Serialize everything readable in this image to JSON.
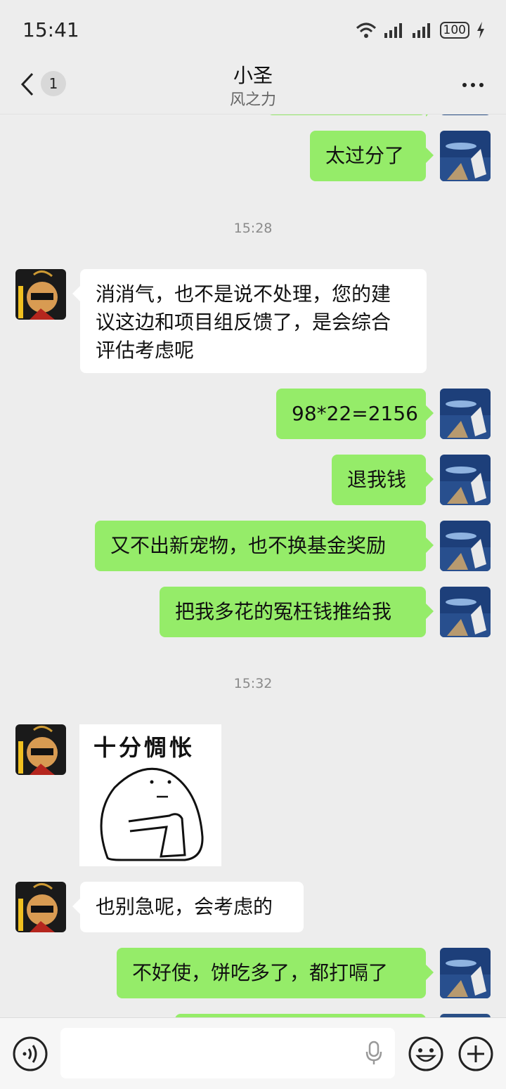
{
  "status": {
    "time": "15:41",
    "battery": "100"
  },
  "header": {
    "unread": "1",
    "name": "小圣",
    "subtitle": "风之力"
  },
  "messages": [
    {
      "text": "太过分了"
    },
    {
      "time": "15:28"
    },
    {
      "lines": [
        "消消气，也不是说不处理，您的建",
        "议这边和项目组反馈了，是会综合",
        "评估考虑呢"
      ]
    },
    {
      "text": "98*22=2156"
    },
    {
      "text": "退我钱"
    },
    {
      "text": "又不出新宠物，也不换基金奖励"
    },
    {
      "text": "把我多花的冤枉钱推给我"
    },
    {
      "time": "15:32"
    },
    {
      "sticker_text": "十分惆怅"
    },
    {
      "text": "也别急呢，会考虑的"
    },
    {
      "text": "不好使，饼吃多了，都打嗝了"
    }
  ],
  "icons": {
    "back": "chevron-left-icon",
    "more": "more-dots-icon",
    "voice": "voice-icon",
    "mic": "microphone-icon",
    "emoji": "emoji-icon",
    "plus": "plus-icon",
    "wifi": "wifi-icon",
    "signal": "signal-icon",
    "charging": "charging-icon"
  },
  "colors": {
    "my_bubble": "#95ec69",
    "their_bubble": "#ffffff",
    "background": "#ededed"
  }
}
